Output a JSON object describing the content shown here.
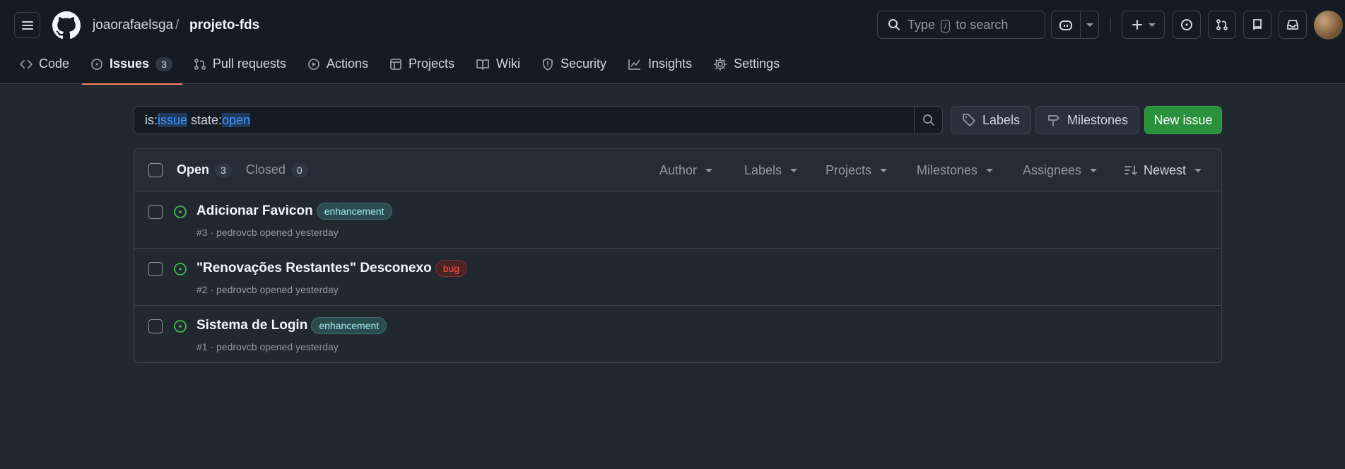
{
  "header": {
    "owner": "joaorafaelsga",
    "separator": "/",
    "repo": "projeto-fds",
    "search_prefix": "Type",
    "search_key": "/",
    "search_suffix": "to search"
  },
  "tabs": [
    {
      "label": "Code",
      "icon": "code-icon"
    },
    {
      "label": "Issues",
      "icon": "issue-opened-icon",
      "count": "3",
      "selected": true
    },
    {
      "label": "Pull requests",
      "icon": "git-pull-request-icon"
    },
    {
      "label": "Actions",
      "icon": "play-icon"
    },
    {
      "label": "Projects",
      "icon": "table-icon"
    },
    {
      "label": "Wiki",
      "icon": "book-icon"
    },
    {
      "label": "Security",
      "icon": "shield-icon"
    },
    {
      "label": "Insights",
      "icon": "graph-icon"
    },
    {
      "label": "Settings",
      "icon": "gear-icon"
    }
  ],
  "toolbar": {
    "filter_is": "is:",
    "filter_issue": "issue",
    "filter_state": " state:",
    "filter_open": "open",
    "labels_button": "Labels",
    "milestones_button": "Milestones",
    "new_issue_button": "New issue"
  },
  "list_header": {
    "open_label": "Open",
    "open_count": "3",
    "closed_label": "Closed",
    "closed_count": "0",
    "filters": [
      "Author",
      "Labels",
      "Projects",
      "Milestones",
      "Assignees"
    ],
    "sort_label": "Newest"
  },
  "issues": [
    {
      "title": "Adicionar Favicon",
      "label": "enhancement",
      "label_kind": "enhancement",
      "meta": "#3 · pedrovcb opened yesterday"
    },
    {
      "title": "\"Renovações Restantes\" Desconexo",
      "label": "bug",
      "label_kind": "bug",
      "meta": "#2 · pedrovcb opened yesterday"
    },
    {
      "title": "Sistema de Login",
      "label": "enhancement",
      "label_kind": "enhancement",
      "meta": "#1 · pedrovcb opened yesterday"
    }
  ],
  "colors": {
    "accent_underline": "#f78166",
    "open_icon": "#3fb950",
    "primary_button": "#29903b"
  }
}
